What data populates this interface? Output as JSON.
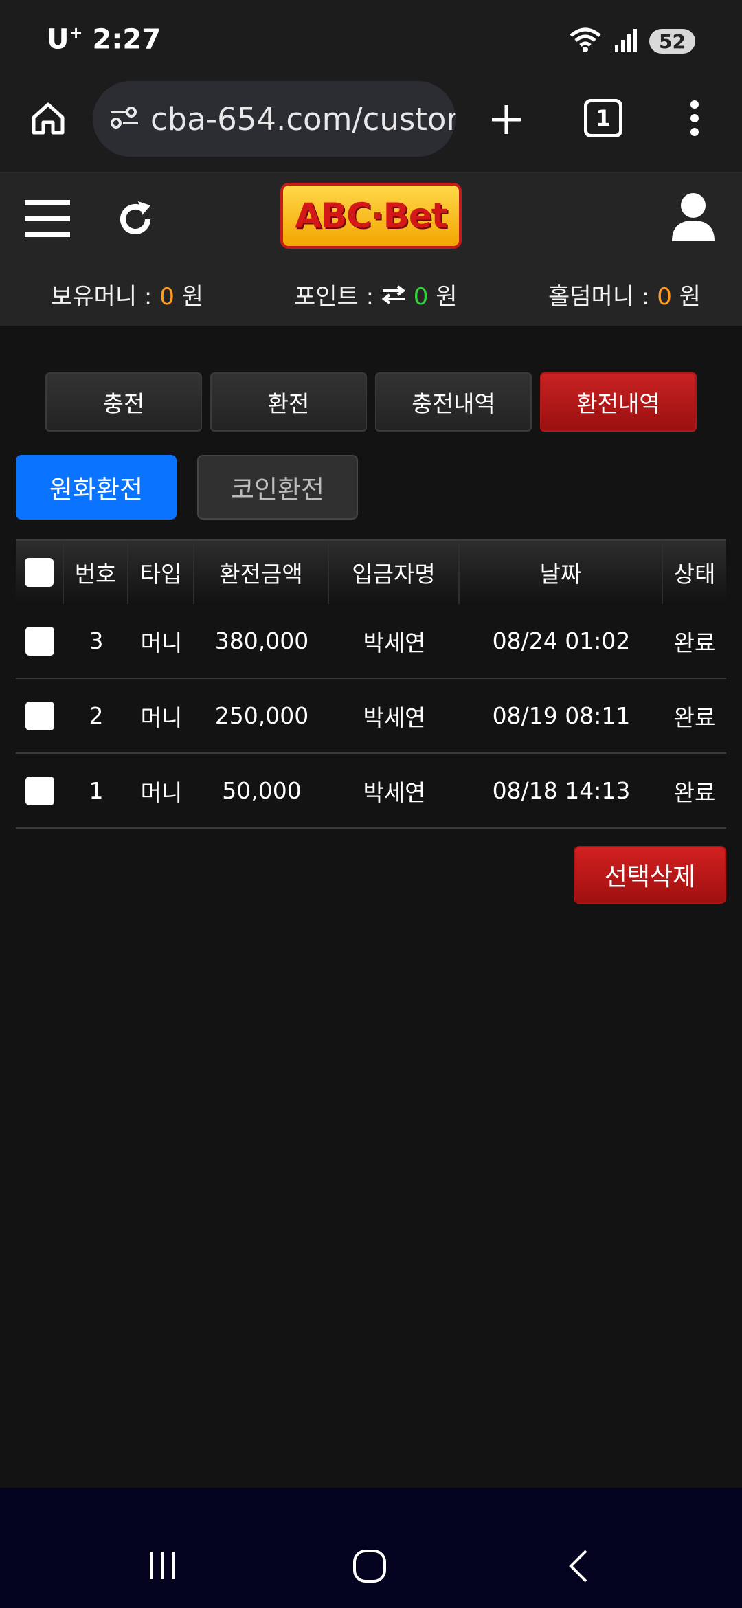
{
  "status_bar": {
    "carrier": "U",
    "carrier_sup": "+",
    "time": "2:27",
    "battery": "52"
  },
  "browser": {
    "url": "cba-654.com/custon",
    "tab_count": "1"
  },
  "site": {
    "logo_text": "ABC·Bet",
    "wallet": [
      {
        "label": "보유머니 :",
        "value": "0",
        "unit": "원"
      },
      {
        "label": "포인트 :",
        "value": "0",
        "unit": "원"
      },
      {
        "label": "홀덤머니 :",
        "value": "0",
        "unit": "원"
      }
    ]
  },
  "tabs": [
    "충전",
    "환전",
    "충전내역",
    "환전내역"
  ],
  "active_tab": "환전내역",
  "subtabs": [
    "원화환전",
    "코인환전"
  ],
  "table": {
    "headers": [
      "번호",
      "타입",
      "환전금액",
      "입금자명",
      "날짜",
      "상태"
    ],
    "rows": [
      {
        "no": "3",
        "type": "머니",
        "amount": "380,000",
        "name": "박세연",
        "date": "08/24 01:02",
        "status": "완료"
      },
      {
        "no": "2",
        "type": "머니",
        "amount": "250,000",
        "name": "박세연",
        "date": "08/19 08:11",
        "status": "완료"
      },
      {
        "no": "1",
        "type": "머니",
        "amount": "50,000",
        "name": "박세연",
        "date": "08/18 14:13",
        "status": "완료"
      }
    ]
  },
  "delete_label": "선택삭제",
  "colors": {
    "accent_red": "#b41515",
    "primary_blue": "#0a73ff",
    "value_orange": "#ff9d1f",
    "point_green": "#33d13a"
  }
}
